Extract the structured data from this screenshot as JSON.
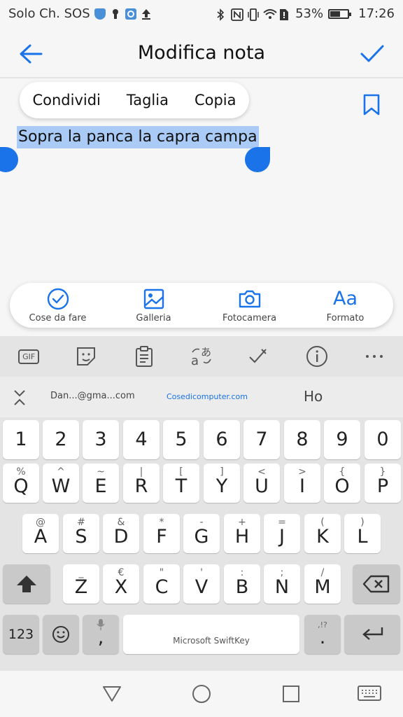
{
  "status_bar": {
    "carrier": "Solo Ch. SOS",
    "battery": "53%",
    "time": "17:26"
  },
  "app_bar": {
    "title": "Modifica nota"
  },
  "context_menu": {
    "share": "Condividi",
    "cut": "Taglia",
    "copy": "Copia"
  },
  "note": {
    "text": "Sopra la panca la capra campa"
  },
  "toolbar": {
    "todo": "Cose da fare",
    "gallery": "Galleria",
    "camera": "Fotocamera",
    "format": "Formato",
    "format_icon_text": "Aa"
  },
  "keyboard": {
    "top_gif": "GIF",
    "suggestions": {
      "s1": "Dan...@gma...com",
      "s2": "Cosedicomputer.com",
      "s3": "Ho"
    },
    "numbers": [
      "1",
      "2",
      "3",
      "4",
      "5",
      "6",
      "7",
      "8",
      "9",
      "0"
    ],
    "row1": [
      [
        "Q",
        "%"
      ],
      [
        "W",
        "^"
      ],
      [
        "E",
        "~"
      ],
      [
        "R",
        "|"
      ],
      [
        "T",
        "["
      ],
      [
        "Y",
        "]"
      ],
      [
        "U",
        "<"
      ],
      [
        "I",
        ">"
      ],
      [
        "O",
        "{"
      ],
      [
        "P",
        "}"
      ]
    ],
    "row2": [
      [
        "A",
        "@"
      ],
      [
        "S",
        "#"
      ],
      [
        "D",
        "&"
      ],
      [
        "F",
        "*"
      ],
      [
        "G",
        "-"
      ],
      [
        "H",
        "+"
      ],
      [
        "J",
        "="
      ],
      [
        "K",
        "("
      ],
      [
        "L",
        ")"
      ]
    ],
    "row3": [
      [
        "Z",
        "_"
      ],
      [
        "X",
        "€"
      ],
      [
        "C",
        "\""
      ],
      [
        "V",
        "'"
      ],
      [
        "B",
        ":"
      ],
      [
        "N",
        ";"
      ],
      [
        "M",
        "/"
      ]
    ],
    "key_123": "123",
    "comma": ",",
    "space_label": "Microsoft SwiftKey",
    "period": ".",
    "period_sec": ",!?"
  },
  "colors": {
    "accent": "#1a73e8",
    "selection": "#a9cbf6"
  }
}
